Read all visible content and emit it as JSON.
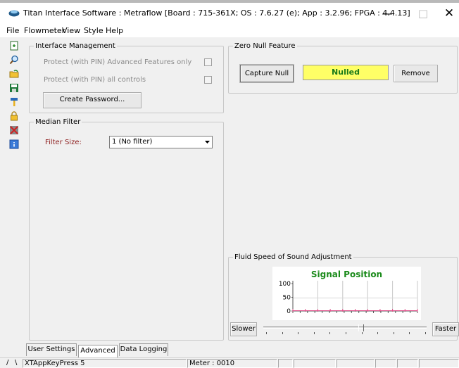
{
  "window": {
    "title": "Titan Interface Software : Metraflow [Board : 715-361X; OS : 7.6.27 (e); App : 3.2.96; FPGA : 4.4.13]",
    "minimize": "—",
    "maximize": "□",
    "close": "✕"
  },
  "menu": [
    "File",
    "Flowmeter",
    "View",
    "Style",
    "Help"
  ],
  "toolbar": {
    "icons": [
      "page-icon",
      "magnifier-icon",
      "open-folder-icon",
      "save-disk-icon",
      "tool-icon",
      "lock-icon",
      "crossed-out-icon",
      "info-icon"
    ]
  },
  "interface_management": {
    "legend": "Interface Management",
    "protect_advanced": "Protect (with PIN) Advanced Features only",
    "protect_all": "Protect (with PIN) all controls",
    "create_password": "Create Password..."
  },
  "median_filter": {
    "legend": "Median Filter",
    "filter_size_label": "Filter Size:",
    "filter_size_value": "1 (No filter)"
  },
  "zero_null": {
    "legend": "Zero Null Feature",
    "capture": "Capture Null",
    "status": "Nulled",
    "remove": "Remove",
    "status_color": "#ffff66"
  },
  "speed_of_sound": {
    "legend": "Fluid Speed of Sound Adjustment",
    "slower": "Slower",
    "faster": "Faster"
  },
  "chart_data": {
    "type": "line",
    "title": "Signal Position",
    "xlabel": "",
    "ylabel": "",
    "ylim": [
      0,
      100
    ],
    "yticks": [
      "100",
      "50",
      "0"
    ],
    "series": [
      {
        "values": [
          0,
          0,
          0,
          0,
          0,
          0,
          0,
          0,
          0,
          0,
          0
        ]
      }
    ],
    "grid": true,
    "series_color": "#e0508a"
  },
  "tabs": [
    "User Settings",
    "Advanced",
    "Data Logging"
  ],
  "active_tab": "Advanced",
  "statusbar": {
    "indicator1": "/",
    "indicator2": "\\",
    "message": "XTAppKeyPress 5",
    "meter": "Meter : 0010"
  }
}
